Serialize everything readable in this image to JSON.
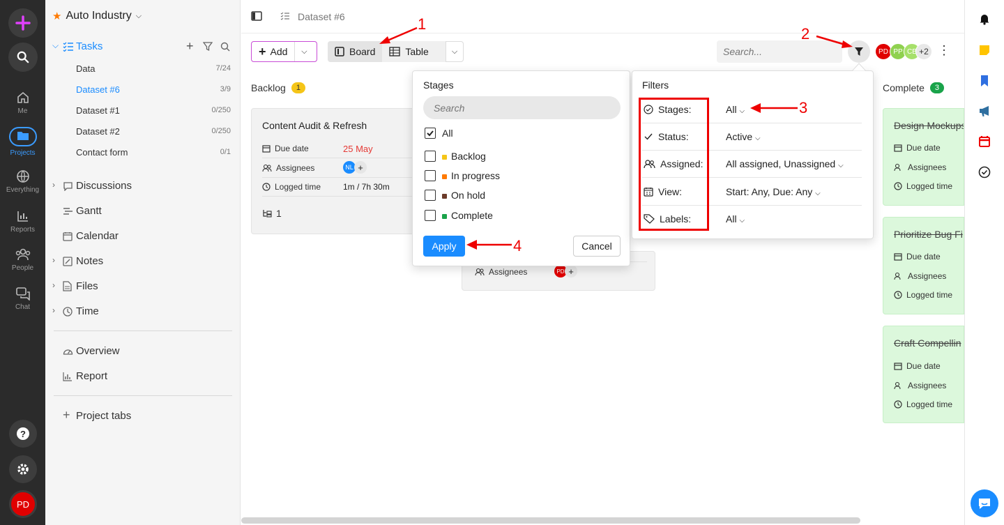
{
  "rail": {
    "me": "Me",
    "projects": "Projects",
    "everything": "Everything",
    "reports": "Reports",
    "people": "People",
    "chat": "Chat",
    "avatar": "PD"
  },
  "sidebar": {
    "workspace": "Auto Industry",
    "tasks": "Tasks",
    "task_lists": [
      {
        "name": "Data",
        "count": "7/24"
      },
      {
        "name": "Dataset #6",
        "count": "3/9"
      },
      {
        "name": "Dataset #1",
        "count": "0/250"
      },
      {
        "name": "Dataset #2",
        "count": "0/250"
      },
      {
        "name": "Contact form",
        "count": "0/1"
      }
    ],
    "discussions": "Discussions",
    "gantt": "Gantt",
    "calendar": "Calendar",
    "notes": "Notes",
    "files": "Files",
    "time": "Time",
    "overview": "Overview",
    "report": "Report",
    "project_tabs": "Project tabs"
  },
  "topbar": {
    "breadcrumb": "Dataset #6"
  },
  "toolbar": {
    "add": "Add",
    "board": "Board",
    "table": "Table",
    "search_placeholder": "Search...",
    "avatars": [
      {
        "initials": "PD",
        "color": "#e00000"
      },
      {
        "initials": "PP",
        "color": "#8fd14f"
      },
      {
        "initials": "CB",
        "color": "#a6e06a"
      },
      {
        "initials": "+2",
        "color": "#e8e8e8"
      }
    ]
  },
  "columns": {
    "backlog": {
      "title": "Backlog",
      "count": "1",
      "color": "#f5c518"
    },
    "complete": {
      "title": "Complete",
      "count": "3",
      "color": "#1aa34a"
    }
  },
  "card_backlog": {
    "title": "Content Audit & Refresh",
    "due_label": "Due date",
    "due_value": "25 May",
    "assignees_label": "Assignees",
    "assignee": "NL",
    "logged_label": "Logged time",
    "logged_value": "1m / 7h 30m",
    "subtasks": "1"
  },
  "card_middle": {
    "assignees_label": "Assignees",
    "assignee": "PD"
  },
  "complete_cards": [
    {
      "title": "Design Mockups",
      "due": "Due date",
      "assignees": "Assignees",
      "logged": "Logged time"
    },
    {
      "title": "Prioritize Bug Fi",
      "due": "Due date",
      "assignees": "Assignees",
      "logged": "Logged time"
    },
    {
      "title": "Craft Compellin",
      "due": "Due date",
      "assignees": "Assignees",
      "logged": "Logged time"
    }
  ],
  "stages_dropdown": {
    "title": "Stages",
    "search_placeholder": "Search",
    "options": [
      {
        "label": "All",
        "checked": true,
        "color": ""
      },
      {
        "label": "Backlog",
        "checked": false,
        "color": "#f5c518"
      },
      {
        "label": "In progress",
        "checked": false,
        "color": "#ff7a00"
      },
      {
        "label": "On hold",
        "checked": false,
        "color": "#6b3b2a"
      },
      {
        "label": "Complete",
        "checked": false,
        "color": "#1aa34a"
      }
    ],
    "apply": "Apply",
    "cancel": "Cancel"
  },
  "filters": {
    "title": "Filters",
    "rows": [
      {
        "key": "Stages:",
        "value": "All"
      },
      {
        "key": "Status:",
        "value": "Active"
      },
      {
        "key": "Assigned:",
        "value": "All assigned, Unassigned"
      },
      {
        "key": "View:",
        "value": "Start: Any, Due: Any"
      },
      {
        "key": "Labels:",
        "value": "All"
      }
    ]
  },
  "annotations": [
    "1",
    "2",
    "3",
    "4"
  ]
}
